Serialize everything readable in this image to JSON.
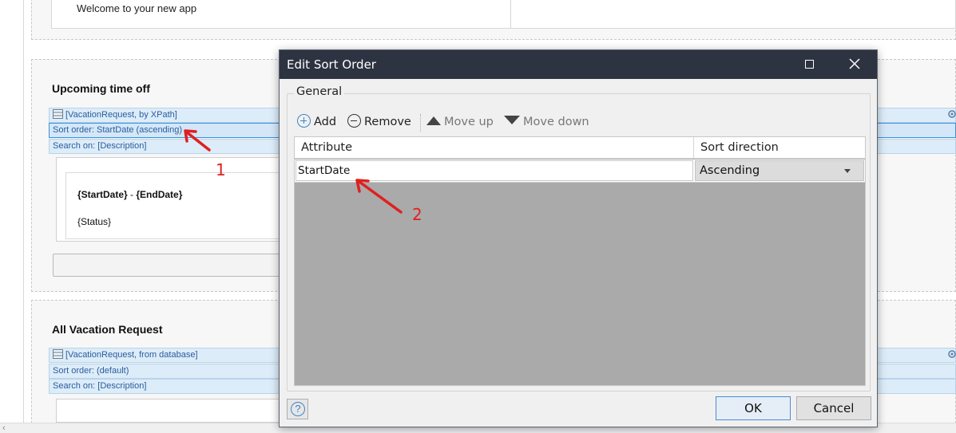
{
  "background": {
    "welcome_text": "Welcome to your new app",
    "sections": [
      {
        "title": "Upcoming time off",
        "datasource": "[VacationRequest, by XPath]",
        "sort_order": "Sort order: StartDate (ascending)",
        "search_on": "Search on: [Description]",
        "dates_start": "{StartDate}",
        "dates_sep": " - ",
        "dates_end": "{EndDate}",
        "status": "{Status}"
      },
      {
        "title": "All Vacation Request",
        "datasource": "[VacationRequest, from database]",
        "sort_order": "Sort order: (default)",
        "search_on": "Search on: [Description]"
      }
    ],
    "callouts": [
      "1",
      "2"
    ]
  },
  "dialog": {
    "title": "Edit Sort Order",
    "group_label": "General",
    "toolbar": {
      "add": "Add",
      "remove": "Remove",
      "move_up": "Move up",
      "move_down": "Move down"
    },
    "columns": [
      "Attribute",
      "Sort direction"
    ],
    "rows": [
      {
        "attribute": "StartDate",
        "direction": "Ascending"
      }
    ],
    "buttons": {
      "ok": "OK",
      "cancel": "Cancel",
      "help": "?"
    }
  },
  "colors": {
    "titlebar": "#2d3340",
    "accent": "#3a87c8",
    "callout": "#e02020",
    "grid_empty": "#aaaaaa"
  }
}
